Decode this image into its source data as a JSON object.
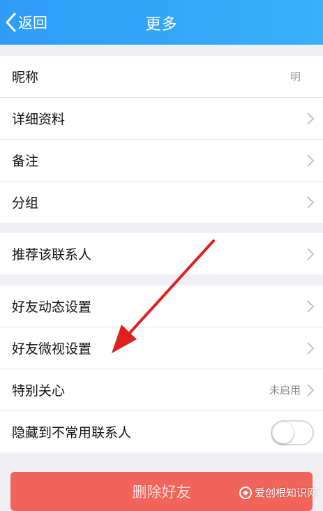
{
  "header": {
    "back_label": "返回",
    "title": "更多"
  },
  "group1": [
    {
      "label": "昵称",
      "value": "明"
    },
    {
      "label": "详细资料"
    },
    {
      "label": "备注"
    },
    {
      "label": "分组"
    }
  ],
  "group2": [
    {
      "label": "推荐该联系人"
    }
  ],
  "group3": [
    {
      "label": "好友动态设置"
    },
    {
      "label": "好友微视设置"
    },
    {
      "label": "特别关心",
      "value": "未启用"
    },
    {
      "label": "隐藏到不常用联系人",
      "toggle_on": false
    }
  ],
  "delete_button": "删除好友",
  "watermark": "爱创根知识网",
  "colors": {
    "header": "#2f9cf7",
    "delete": "#f0645a",
    "arrow": "#e02020"
  }
}
